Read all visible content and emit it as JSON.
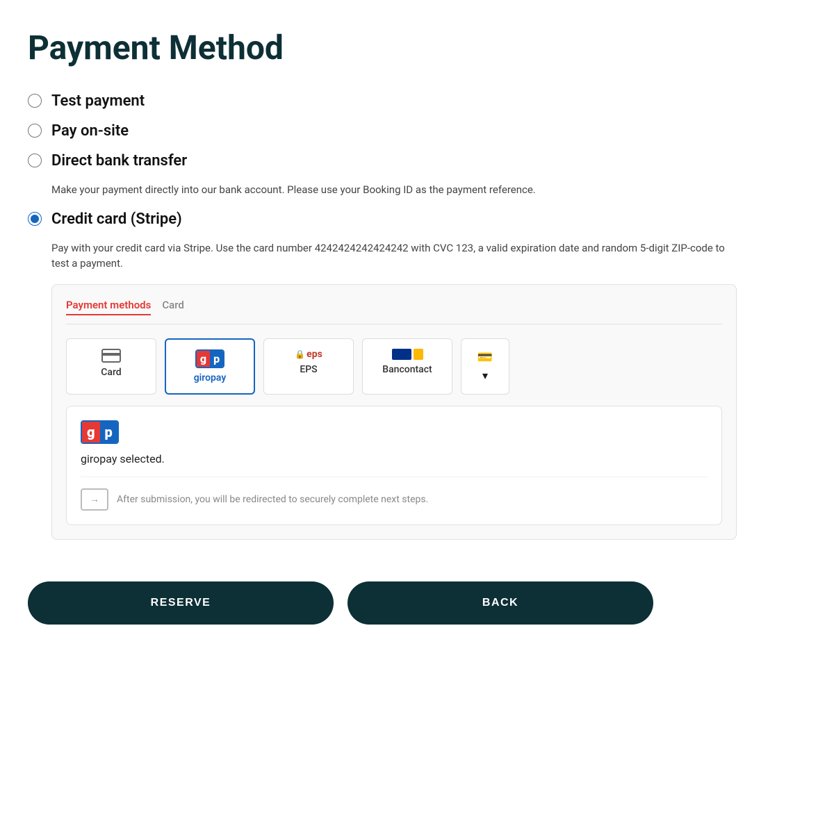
{
  "page": {
    "title": "Payment Method"
  },
  "payment_options": [
    {
      "id": "test_payment",
      "label": "Test payment",
      "selected": false,
      "description": null
    },
    {
      "id": "pay_onsite",
      "label": "Pay on-site",
      "selected": false,
      "description": null
    },
    {
      "id": "direct_bank_transfer",
      "label": "Direct bank transfer",
      "selected": false,
      "description": "Make your payment directly into our bank account. Please use your Booking ID as the payment reference."
    },
    {
      "id": "credit_card_stripe",
      "label": "Credit card (Stripe)",
      "selected": true,
      "description": "Pay with your credit card via Stripe. Use the card number 4242424242424242 with CVC 123, a valid expiration date and random 5-digit ZIP-code to test a payment."
    }
  ],
  "stripe": {
    "tabs": [
      {
        "id": "payment_methods",
        "label": "Payment methods",
        "active": true
      },
      {
        "id": "card",
        "label": "Card",
        "active": false
      }
    ],
    "methods": [
      {
        "id": "card",
        "label": "Card",
        "selected": false
      },
      {
        "id": "giropay",
        "label": "giropay",
        "selected": true
      },
      {
        "id": "eps",
        "label": "EPS",
        "selected": false
      },
      {
        "id": "bancontact",
        "label": "Bancontact",
        "selected": false
      }
    ],
    "more_button_label": "▾",
    "selected_method": {
      "id": "giropay",
      "name": "giropay",
      "selected_text": "giropay selected.",
      "redirect_text": "After submission, you will be redirected to securely complete next steps."
    }
  },
  "buttons": {
    "reserve_label": "RESERVE",
    "back_label": "BACK"
  }
}
